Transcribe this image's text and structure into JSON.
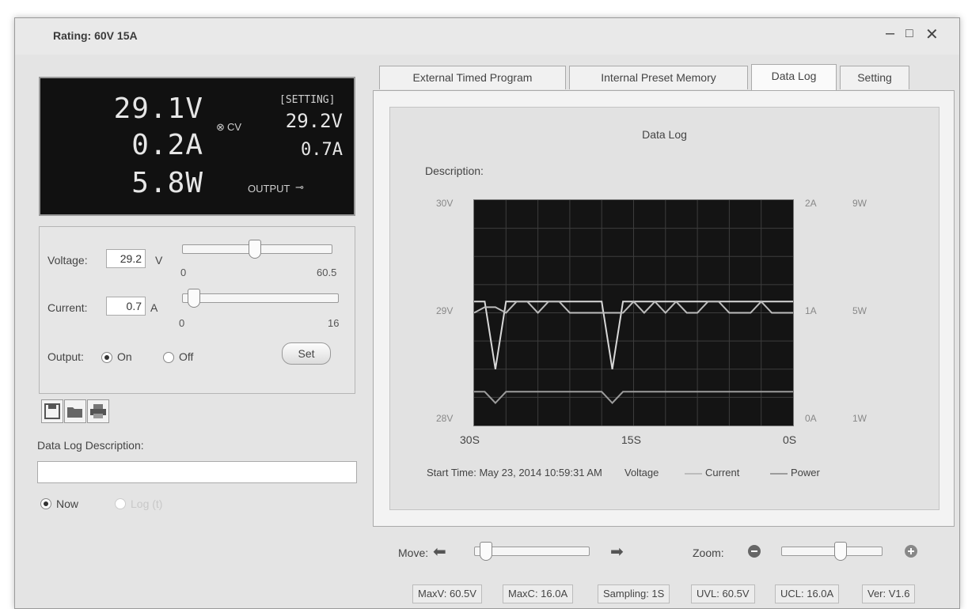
{
  "window": {
    "title": "Rating: 60V 15A",
    "minimize": "–",
    "maximize": "□",
    "close": "✕"
  },
  "display": {
    "voltage": "29.1V",
    "current": "0.2A",
    "power": "5.8W",
    "mode": "CV",
    "setting_label": "[SETTING]",
    "set_voltage": "29.2V",
    "set_current": "0.7A",
    "output_label": "OUTPUT"
  },
  "controls": {
    "voltage_label": "Voltage:",
    "voltage_value": "29.2",
    "voltage_unit": "V",
    "voltage_min": "0",
    "voltage_max": "60.5",
    "voltage_level": 0.48,
    "current_label": "Current:",
    "current_value": "0.7",
    "current_unit": "A",
    "current_min": "0",
    "current_max": "16",
    "current_level": 0.04,
    "output_label": "Output:",
    "on_label": "On",
    "off_label": "Off",
    "output_selected": "On",
    "set_button": "Set"
  },
  "toolbar": {
    "icons": [
      "save-icon",
      "open-folder-icon",
      "print-icon"
    ]
  },
  "datalog": {
    "description_label": "Data Log Description:",
    "description_value": "",
    "now_label": "Now",
    "log_label": "Log (t)"
  },
  "tabs": [
    {
      "label": "External Timed Program"
    },
    {
      "label": "Internal Preset Memory"
    },
    {
      "label": "Data Log",
      "active": true
    },
    {
      "label": "Setting"
    }
  ],
  "chart_data": {
    "type": "line",
    "title": "Data Log",
    "description_label": "Description:",
    "x_ticks": [
      "30S",
      "15S",
      "0S"
    ],
    "y_left_ticks": [
      "30V",
      "29V",
      "28V"
    ],
    "y_right_ticks_a": [
      "2A",
      "1A",
      "0A"
    ],
    "y_right_ticks_w": [
      "9W",
      "5W",
      "1W"
    ],
    "x": [
      30,
      29,
      28,
      27,
      26,
      25,
      24,
      23,
      22,
      21,
      20,
      19,
      18,
      17,
      16,
      15,
      14,
      13,
      12,
      11,
      10,
      9,
      8,
      7,
      6,
      5,
      4,
      3,
      2,
      1,
      0
    ],
    "series": [
      {
        "name": "Voltage",
        "color": "#d8d8d8",
        "axis": "V",
        "values": [
          29.1,
          29.1,
          28.5,
          29.1,
          29.1,
          29.1,
          29.1,
          29.1,
          29.1,
          29.1,
          29.1,
          29.1,
          29.1,
          28.5,
          29.1,
          29.1,
          29.1,
          29.1,
          29.1,
          29.1,
          29.1,
          29.1,
          29.1,
          29.1,
          29.1,
          29.1,
          29.1,
          29.1,
          29.1,
          29.1,
          29.1
        ]
      },
      {
        "name": "Current",
        "color": "#bcbcbc",
        "axis": "A",
        "values": [
          1.0,
          1.05,
          1.05,
          1.0,
          1.1,
          1.1,
          1.0,
          1.1,
          1.1,
          1.0,
          1.0,
          1.0,
          1.0,
          1.0,
          1.0,
          1.1,
          1.0,
          1.1,
          1.0,
          1.1,
          1.0,
          1.0,
          1.1,
          1.1,
          1.0,
          1.0,
          1.0,
          1.1,
          1.0,
          1.0,
          1.0
        ]
      },
      {
        "name": "Power",
        "color": "#9c9c9c",
        "axis": "W",
        "values": [
          2.2,
          2.2,
          1.8,
          2.2,
          2.2,
          2.2,
          2.2,
          2.2,
          2.2,
          2.2,
          2.2,
          2.2,
          2.2,
          1.8,
          2.2,
          2.2,
          2.2,
          2.2,
          2.2,
          2.2,
          2.2,
          2.2,
          2.2,
          2.2,
          2.2,
          2.2,
          2.2,
          2.2,
          2.2,
          2.2,
          2.2
        ]
      }
    ],
    "voltage_ylim": [
      28,
      30
    ],
    "current_ylim": [
      0,
      2
    ],
    "power_ylim": [
      1,
      9
    ],
    "grid": true,
    "start_time": "Start Time: May 23, 2014 10:59:31 AM",
    "legend": [
      "Voltage",
      "Current",
      "Power"
    ],
    "legend_placement": "bottom"
  },
  "navigation": {
    "move_label": "Move:",
    "zoom_label": "Zoom:",
    "move_level": 0.05,
    "zoom_level": 0.6
  },
  "status": {
    "maxv": "MaxV: 60.5V",
    "maxc": "MaxC: 16.0A",
    "sampling": "Sampling: 1S",
    "uvl": "UVL: 60.5V",
    "ucl": "UCL: 16.0A",
    "version": "Ver: V1.6"
  }
}
